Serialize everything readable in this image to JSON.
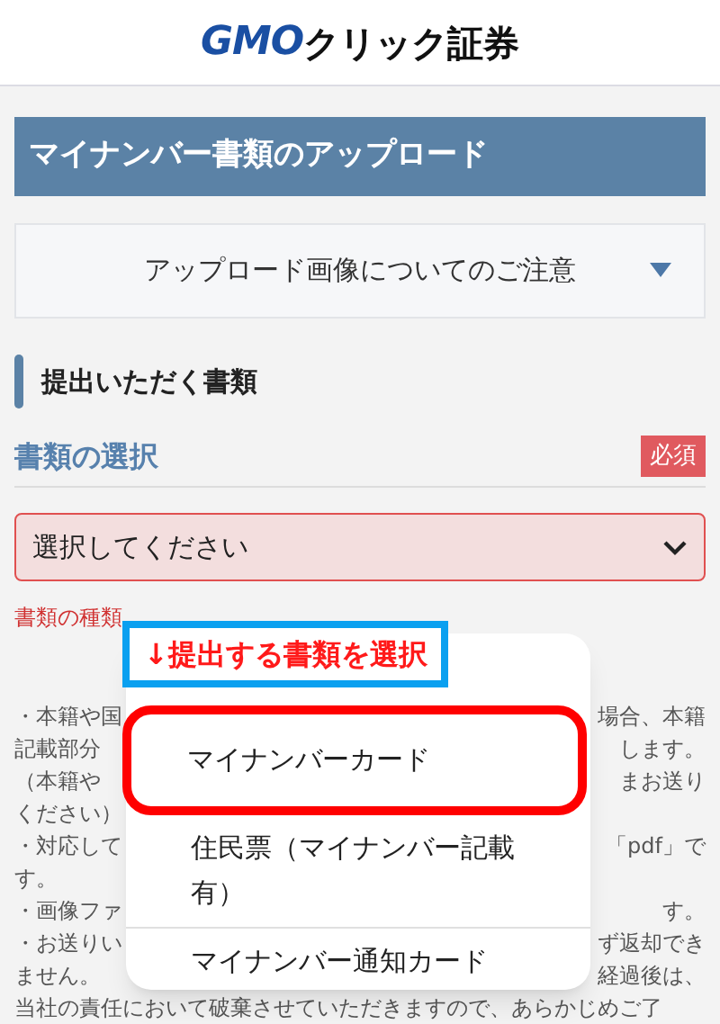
{
  "header": {
    "logo_latin": "GMO",
    "logo_kana": "クリック証券"
  },
  "page_title": "マイナンバー書類のアップロード",
  "notice_accordion": {
    "label": "アップロード画像についてのご注意",
    "expanded": false
  },
  "section_heading": "提出いただく書類",
  "field": {
    "label": "書類の選択",
    "required_badge": "必須",
    "prompt": "選択してください",
    "error": true
  },
  "hint_fragment": "書類の種類",
  "notes_fragments": [
    {
      "left": "・本籍や国",
      "right": "場合、本籍"
    },
    {
      "left": "記載部分",
      "right": "します。"
    },
    {
      "left": "（本籍や",
      "right": "まお送り"
    },
    {
      "left": "ください）"
    },
    {
      "left": "・対応して",
      "right": "「pdf」で"
    },
    {
      "left": "す。"
    },
    {
      "left": "・画像ファ",
      "right": "す。"
    },
    {
      "left": "・お送りい",
      "right": "ず返却でき"
    },
    {
      "left": "ません。",
      "right": "経過後は、"
    },
    {
      "left": "当社の責任において破棄させていただきますので、あらかじめご了"
    }
  ],
  "annotation": "↓提出する書類を選択",
  "dropdown_options": [
    {
      "label": "マイナンバーカード",
      "circled": true
    },
    {
      "label": "住民票（マイナンバー記載有）",
      "circled": false
    },
    {
      "label": "マイナンバー通知カード",
      "circled": false
    }
  ]
}
